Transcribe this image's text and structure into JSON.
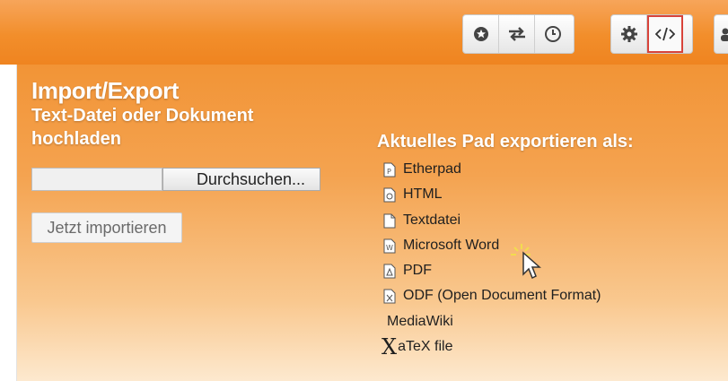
{
  "toolbar": {
    "groups": [
      {
        "buttons": [
          {
            "icon": "star-icon"
          },
          {
            "icon": "sync-arrows-icon"
          },
          {
            "icon": "clock-icon"
          }
        ]
      },
      {
        "buttons": [
          {
            "icon": "gear-icon",
            "active": false
          },
          {
            "icon": "embed-code-icon",
            "active": true
          }
        ]
      },
      {
        "buttons": [
          {
            "icon": "users-icon"
          }
        ]
      }
    ],
    "highlight_color": "#d8433a"
  },
  "import_export": {
    "title": "Import/Export",
    "import_heading": "Text-Datei oder Dokument hochladen",
    "browse_label": "Durchsuchen...",
    "import_button": "Jetzt importieren",
    "export_heading": "Aktuelles Pad exportieren als:",
    "export_items": [
      {
        "label": "Etherpad",
        "icon": "etherpad-file-icon"
      },
      {
        "label": "HTML",
        "icon": "html-file-icon"
      },
      {
        "label": "Textdatei",
        "icon": "text-file-icon"
      },
      {
        "label": "Microsoft Word",
        "icon": "word-file-icon"
      },
      {
        "label": "PDF",
        "icon": "pdf-file-icon"
      },
      {
        "label": "ODF (Open Document Format)",
        "icon": "odf-file-icon"
      },
      {
        "label": "MediaWiki",
        "icon": ""
      },
      {
        "label": "aTeX file",
        "icon": "xatex-logo"
      }
    ]
  },
  "colors": {
    "accent_orange": "#f28e2b",
    "panel_light": "#fde9cf"
  }
}
